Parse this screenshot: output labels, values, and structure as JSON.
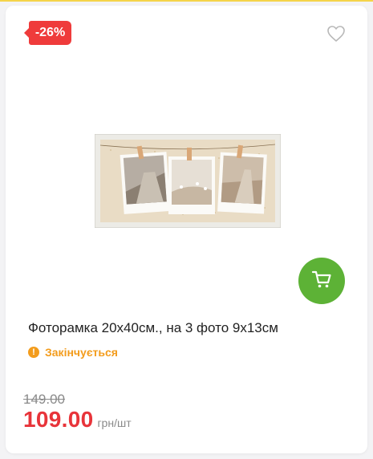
{
  "badge": {
    "discount": "-26%"
  },
  "icons": {
    "favorite": "heart-outline-icon",
    "cart": "shopping-cart-icon",
    "status": "exclamation-icon"
  },
  "product": {
    "title": "Фоторамка 20х40см., на 3 фото 9х13см",
    "status": "Закінчується",
    "old_price": "149.00",
    "price": "109.00",
    "unit": "грн/шт"
  },
  "colors": {
    "badge": "#ef3b3b",
    "cart_button": "#5db236",
    "status": "#f39c1c",
    "price": "#e8343a"
  }
}
